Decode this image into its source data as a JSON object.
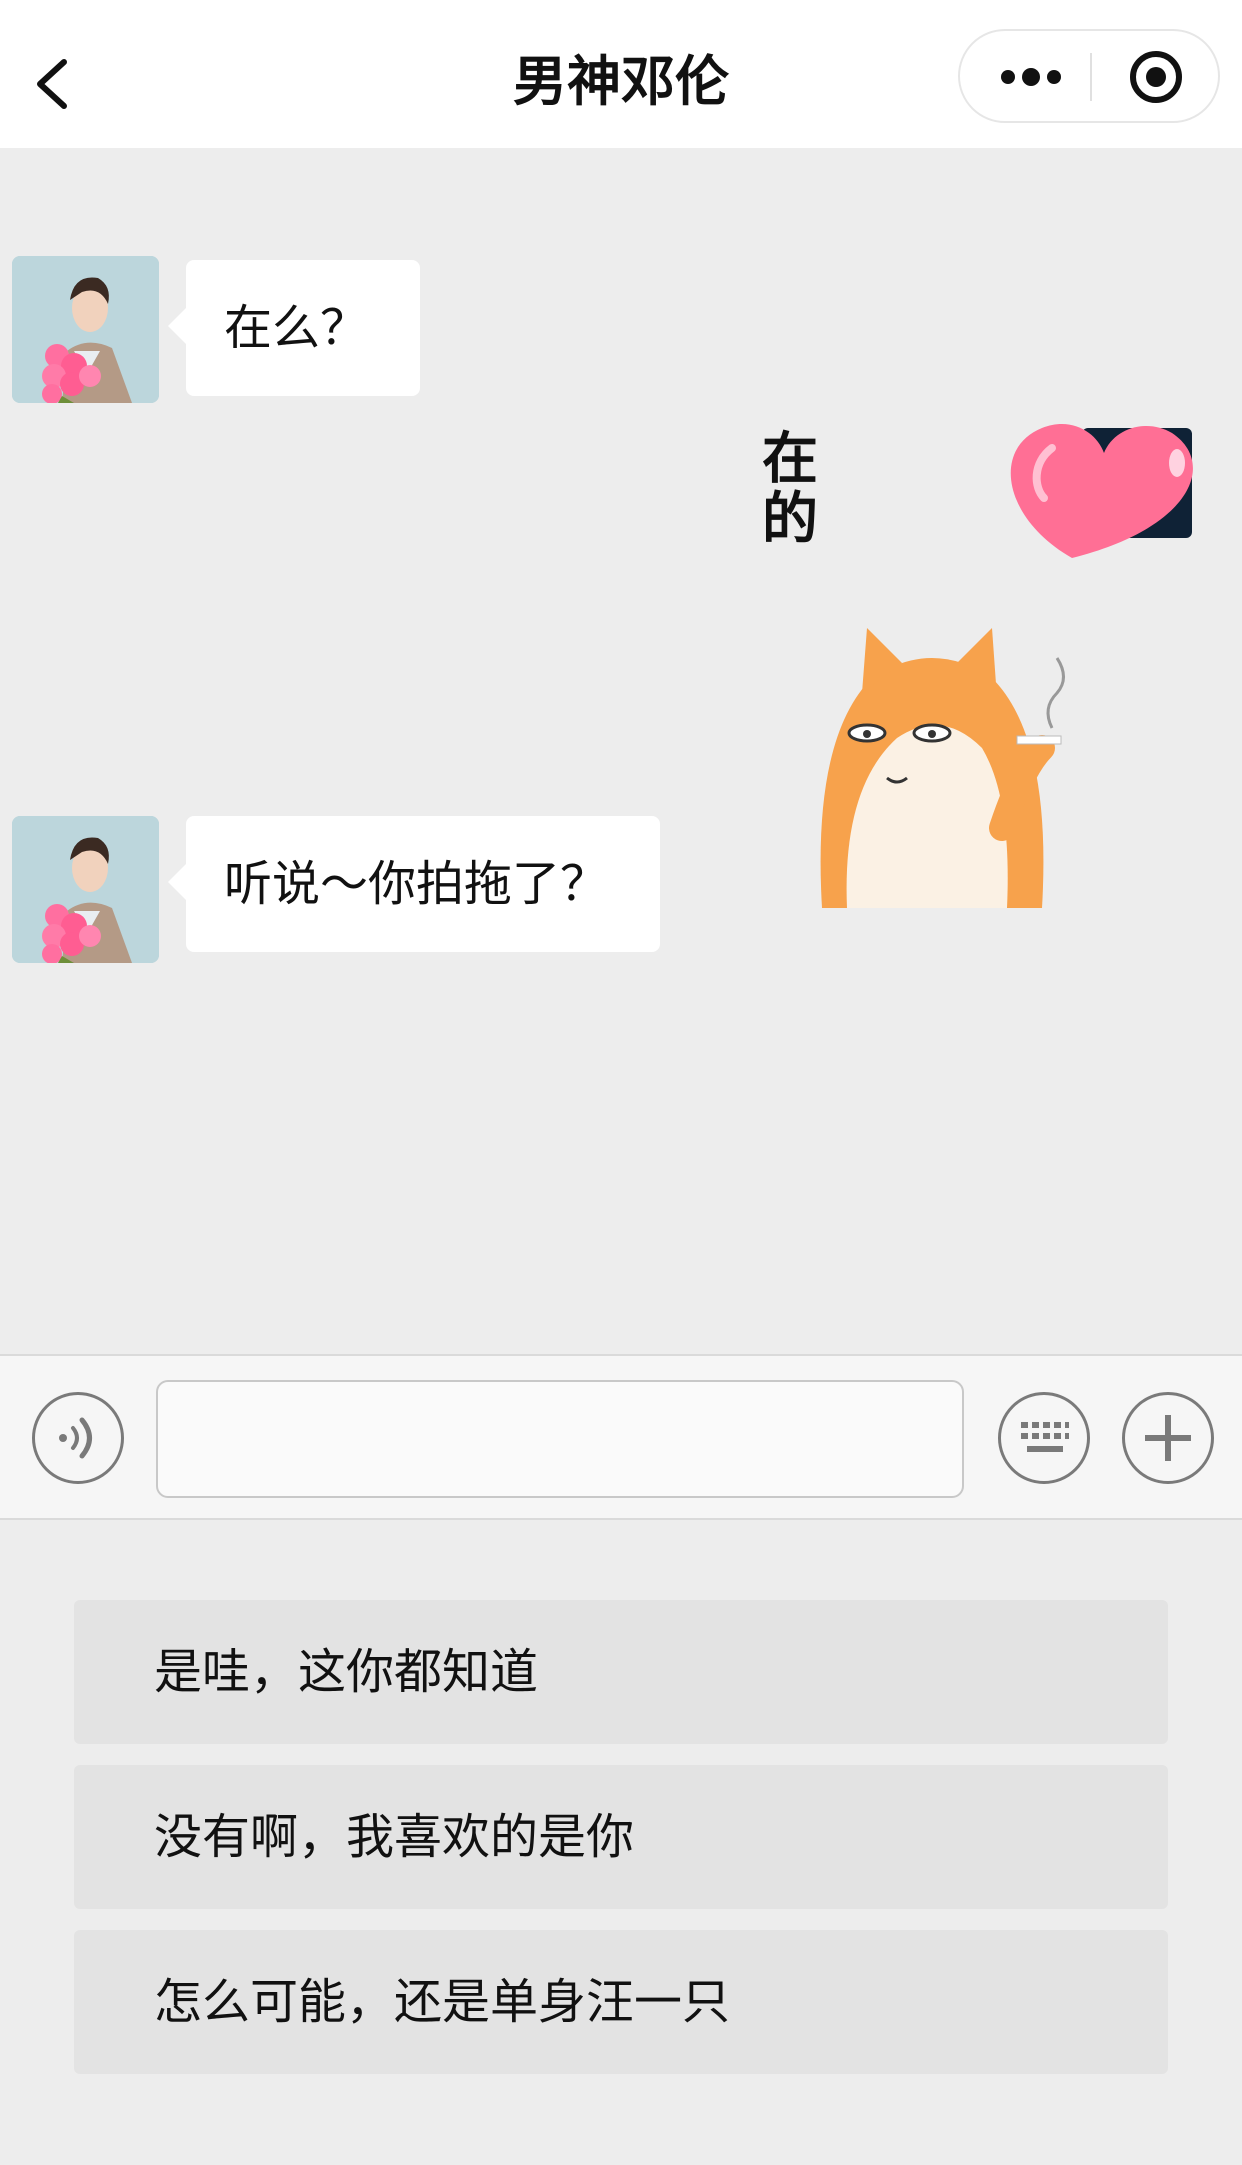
{
  "nav": {
    "title": "男神邓伦"
  },
  "messages": [
    {
      "sender": "contact",
      "text": "在么？"
    },
    {
      "sender": "self",
      "sticker_text": "在的"
    },
    {
      "sender": "contact",
      "text": "听说～你拍拖了？"
    }
  ],
  "input": {
    "value": "",
    "placeholder": ""
  },
  "reply_options": [
    "是哇，这你都知道",
    "没有啊，我喜欢的是你",
    "怎么可能，还是单身汪一只"
  ],
  "colors": {
    "background": "#ededed",
    "bubble": "#ffffff",
    "option": "#e3e3e3",
    "heart": "#ff6f95"
  },
  "icons": {
    "back": "chevron-left-icon",
    "more": "more-dots-icon",
    "target": "target-icon",
    "voice": "voice-icon",
    "keyboard": "keyboard-icon",
    "plus": "plus-icon"
  }
}
